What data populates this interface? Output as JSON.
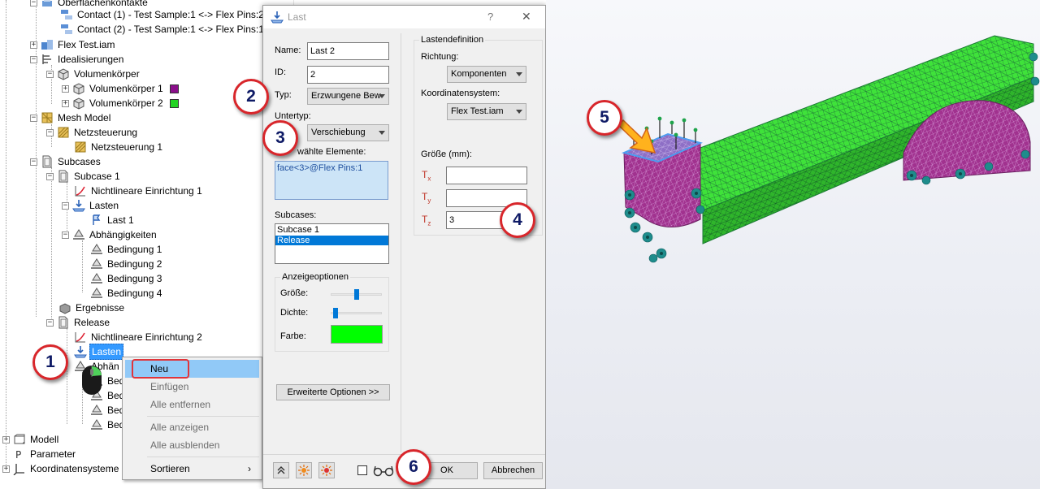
{
  "tree": {
    "items": [
      {
        "label": "Oberflächenkontakte"
      },
      {
        "label": "Contact (1) - Test Sample:1 <-> Flex Pins:2"
      },
      {
        "label": "Contact (2) - Test Sample:1 <-> Flex Pins:1"
      },
      {
        "label": "Flex Test.iam"
      },
      {
        "label": "Idealisierungen"
      },
      {
        "label": "Volumenkörper"
      },
      {
        "label": "Volumenkörper 1",
        "swatch": "#8b0f8b"
      },
      {
        "label": "Volumenkörper 2",
        "swatch": "#22d322"
      },
      {
        "label": "Mesh Model"
      },
      {
        "label": "Netzsteuerung"
      },
      {
        "label": "Netzsteuerung 1"
      },
      {
        "label": "Subcases"
      },
      {
        "label": "Subcase 1"
      },
      {
        "label": "Nichtlineare Einrichtung 1"
      },
      {
        "label": "Lasten"
      },
      {
        "label": "Last 1"
      },
      {
        "label": "Abhängigkeiten"
      },
      {
        "label": "Bedingung 1"
      },
      {
        "label": "Bedingung 2"
      },
      {
        "label": "Bedingung 3"
      },
      {
        "label": "Bedingung 4"
      },
      {
        "label": "Ergebnisse"
      },
      {
        "label": "Release"
      },
      {
        "label": "Nichtlineare Einrichtung 2"
      },
      {
        "label": "Lasten"
      },
      {
        "label": "Abhän"
      },
      {
        "label": "Bed"
      },
      {
        "label": "Bed"
      },
      {
        "label": "Bed"
      },
      {
        "label": "Bed"
      },
      {
        "label": "Modell"
      },
      {
        "label": "Parameter"
      },
      {
        "label": "Koordinatensysteme"
      }
    ]
  },
  "context_menu": {
    "items": [
      {
        "label": "Neu",
        "enabled": true
      },
      {
        "label": "Einfügen",
        "enabled": false
      },
      {
        "label": "Alle entfernen",
        "enabled": false
      },
      {
        "label": "Alle anzeigen",
        "enabled": false
      },
      {
        "label": "Alle ausblenden",
        "enabled": false
      },
      {
        "label": "Sortieren",
        "enabled": true,
        "submenu_arrow": "›"
      }
    ]
  },
  "dialog": {
    "title": "Last",
    "help": "?",
    "close": "✕",
    "name_label": "Name:",
    "name_value": "Last 2",
    "id_label": "ID:",
    "id_value": "2",
    "typ_label": "Typ:",
    "typ_value": "Erzwungene Bew",
    "untertyp_label": "Untertyp:",
    "untertyp_value": "Verschiebung",
    "sel_label": "wählte Elemente:",
    "sel_item": "face<3>@Flex Pins:1",
    "subcases_label": "Subcases:",
    "subcases": [
      "Subcase 1",
      "Release"
    ],
    "anzeige_group": "Anzeigeoptionen",
    "groesse_label": "Größe:",
    "dichte_label": "Dichte:",
    "groesse_level": 0.5,
    "dichte_level": 0.05,
    "farbe_label": "Farbe:",
    "farbe_color": "#00ff00",
    "erweiterte_btn": "Erweiterte Optionen >>",
    "def_group": "Lastendefinition",
    "richtung_label": "Richtung:",
    "richtung_value": "Komponenten",
    "koord_label": "Koordinatensystem:",
    "koord_value": "Flex Test.iam",
    "groesse_mm_label": "Größe (mm):",
    "tx_sym": "T",
    "tx_sub": "x",
    "ty_sym": "T",
    "ty_sub": "y",
    "tz_sym": "T",
    "tz_sub": "z",
    "tx_value": "",
    "ty_value": "",
    "tz_value": "3",
    "ok": "OK",
    "cancel": "Abbrechen"
  },
  "badges": [
    "1",
    "2",
    "3",
    "4",
    "5",
    "6"
  ]
}
